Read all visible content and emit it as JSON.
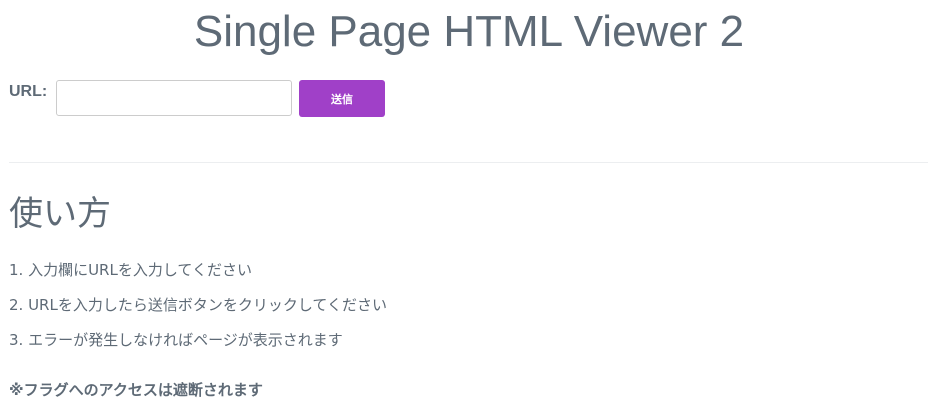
{
  "header": {
    "title": "Single Page HTML Viewer 2"
  },
  "url_form": {
    "label": "URL:",
    "value": "",
    "placeholder": "",
    "submit_label": "送信"
  },
  "howto": {
    "heading": "使い方",
    "steps": [
      "1. 入力欄にURLを入力してください",
      "2. URLを入力したら送信ボタンをクリックしてください",
      "3. エラーが発生しなければページが表示されます"
    ],
    "note": "※フラグへのアクセスは遮断されます"
  },
  "colors": {
    "text": "#5e6a76",
    "accent": "#a040c8",
    "divider": "#eceef0",
    "background": "#ffffff"
  }
}
